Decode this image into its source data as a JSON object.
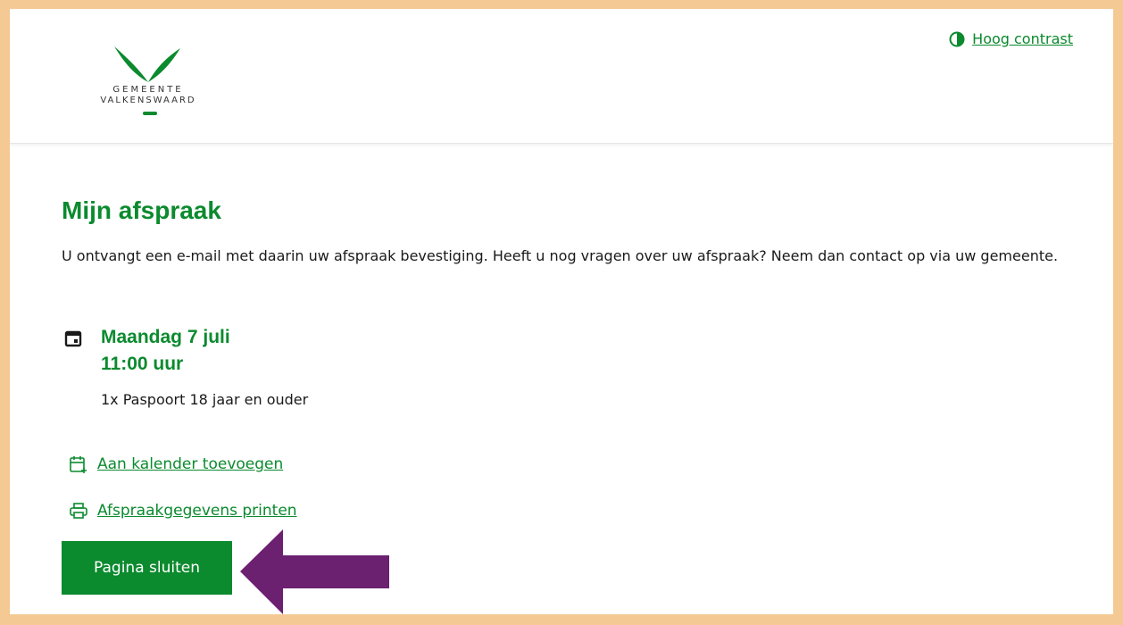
{
  "header": {
    "logo_line1": "GEMEENTE",
    "logo_line2": "VALKENSWAARD",
    "contrast_label": "Hoog contrast"
  },
  "main": {
    "title": "Mijn afspraak",
    "intro": "U ontvangt een e-mail met daarin uw afspraak bevestiging. Heeft u nog vragen over uw afspraak? Neem dan contact op via uw gemeente.",
    "appointment": {
      "date": "Maandag 7 juli",
      "time": "11:00 uur",
      "product": "1x Paspoort 18 jaar en ouder"
    },
    "add_calendar_label": "Aan kalender toevoegen",
    "print_label": "Afspraakgegevens printen",
    "close_button_label": "Pagina sluiten"
  },
  "colors": {
    "brand_green": "#0b8a2e",
    "frame_background": "#f5c993",
    "annotation_arrow": "#6b2070"
  },
  "icons": [
    "contrast-icon",
    "calendar-icon",
    "calendar-add-icon",
    "printer-icon"
  ]
}
